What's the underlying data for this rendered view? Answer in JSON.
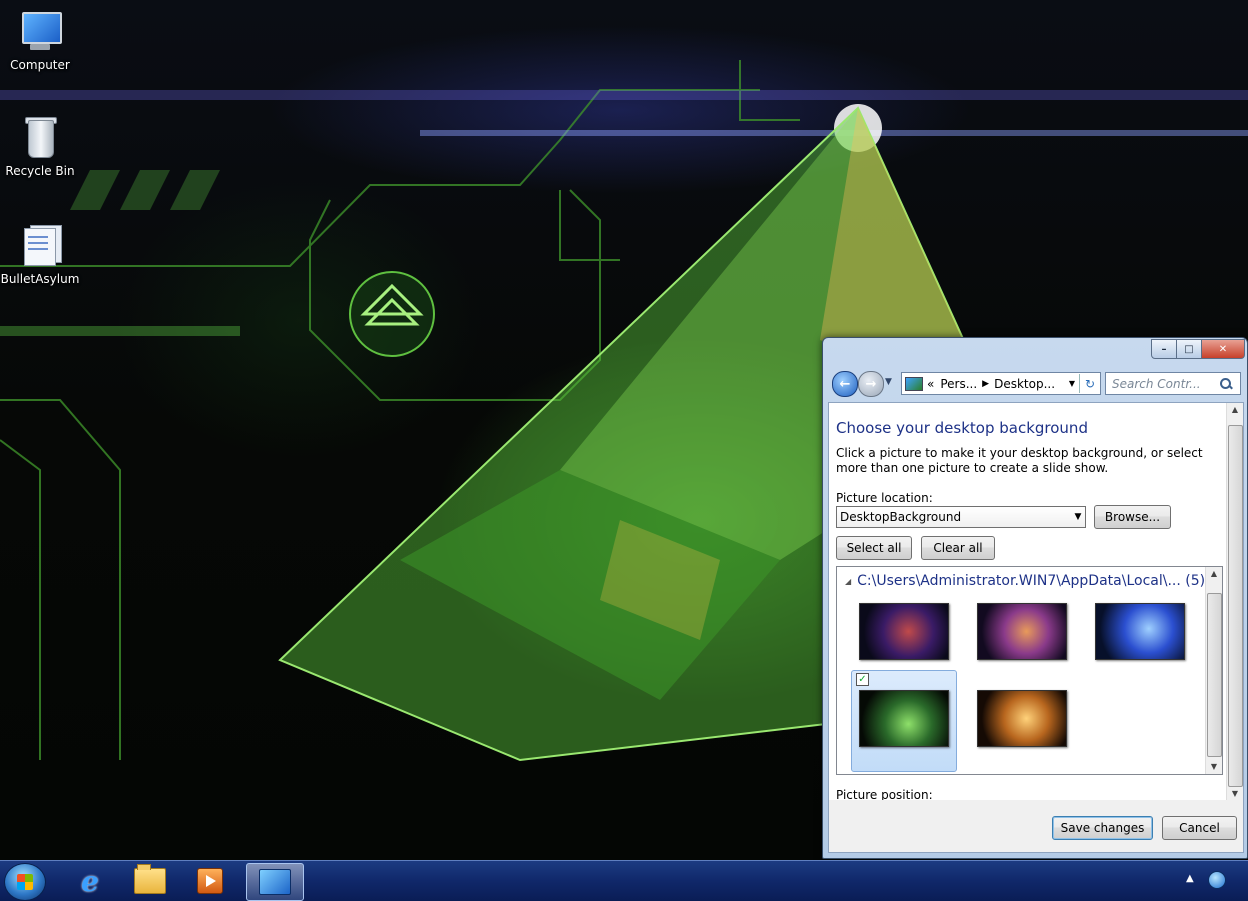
{
  "desktop": {
    "icons": [
      {
        "label": "Computer"
      },
      {
        "label": "Recycle Bin"
      },
      {
        "label": "BulletAsylum"
      }
    ]
  },
  "window": {
    "caption_buttons": {
      "minimize": "–",
      "maximize": "□",
      "close": "✕"
    },
    "nav": {
      "back_glyph": "←",
      "forward_glyph": "→",
      "address_prefix": "«",
      "breadcrumb": [
        "Pers...",
        "Desktop..."
      ],
      "search_placeholder": "Search Contr..."
    },
    "heading": "Choose your desktop background",
    "description": "Click a picture to make it your desktop background, or select more than one picture to create a slide show.",
    "picture_location_label": "Picture location:",
    "picture_location_value": "DesktopBackground",
    "browse_label": "Browse...",
    "select_all_label": "Select all",
    "clear_all_label": "Clear all",
    "group_header": "C:\\Users\\Administrator.WIN7\\AppData\\Local\\...  (5)",
    "thumbnails": [
      {
        "name": "wallpaper-1",
        "selected": false
      },
      {
        "name": "wallpaper-2",
        "selected": false
      },
      {
        "name": "wallpaper-3",
        "selected": false
      },
      {
        "name": "wallpaper-4",
        "selected": true
      },
      {
        "name": "wallpaper-5",
        "selected": false
      }
    ],
    "checkmark": "✓",
    "picture_position_label": "Picture position:",
    "save_label": "Save changes",
    "cancel_label": "Cancel"
  },
  "taskbar": {
    "ie_glyph": "e",
    "tray_arrow": "▲"
  }
}
